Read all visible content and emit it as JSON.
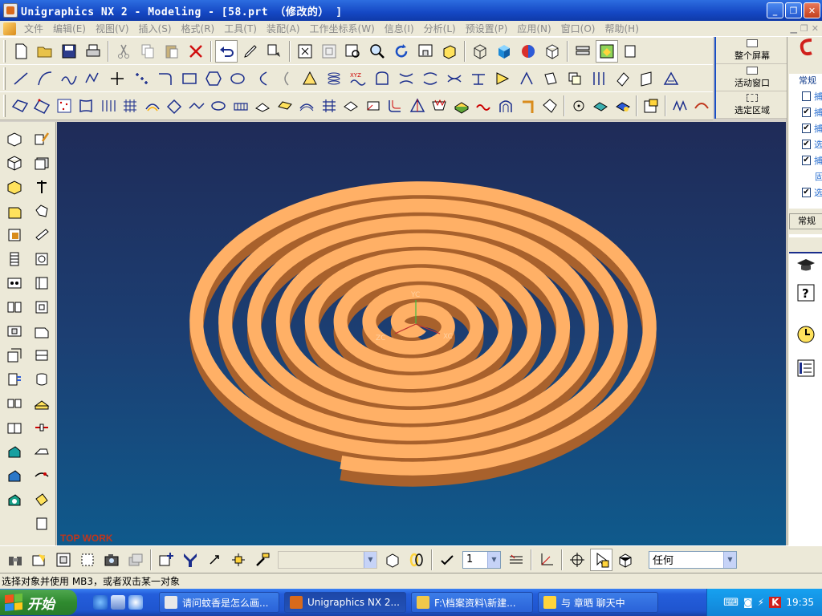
{
  "window": {
    "title": "Unigraphics NX 2 - Modeling - [58.prt （修改的） ]",
    "min": "_",
    "max": "❐",
    "close": "✕"
  },
  "menu": [
    "文件",
    "编辑(E)",
    "视图(V)",
    "插入(S)",
    "格式(R)",
    "工具(T)",
    "装配(A)",
    "工作坐标系(W)",
    "信息(I)",
    "分析(L)",
    "预设置(P)",
    "应用(N)",
    "窗口(O)",
    "帮助(H)"
  ],
  "side_panel": {
    "full_screen": "整个屏幕",
    "active_window": "活动窗口",
    "select_region": "选定区域"
  },
  "resource_bar": {
    "tab_top": "常规",
    "tab_bottom": "常规",
    "checks": [
      {
        "label": "捕",
        "checked": false
      },
      {
        "label": "捕",
        "checked": true
      },
      {
        "label": "捕",
        "checked": true
      },
      {
        "label": "选",
        "checked": true
      },
      {
        "label": "捕",
        "checked": true
      },
      {
        "label": "选",
        "checked": true
      }
    ],
    "extra_label": "固"
  },
  "viewport": {
    "watermark": "TOP WORK",
    "axis_labels": {
      "y": "YC",
      "x": "XC",
      "z": "ZC"
    },
    "colors": {
      "coil_top": "#ffb066",
      "coil_side": "#a8612c",
      "bg_top": "#1f2b58",
      "bg_bottom": "#0f5a8c"
    }
  },
  "bottom_toolbar": {
    "filter_combo": "",
    "layer_combo": "1",
    "type_combo": "任何"
  },
  "status": "选择对象并使用 MB3，或者双击某一对象",
  "taskbar": {
    "start": "开始",
    "tasks": [
      {
        "label": "请问蚊香是怎么画...",
        "active": false
      },
      {
        "label": "Unigraphics NX 2...",
        "active": true
      },
      {
        "label": "F:\\档案资料\\新建...",
        "active": false
      },
      {
        "label": "与 章晒 聊天中",
        "active": false
      }
    ],
    "time": "19:35"
  }
}
